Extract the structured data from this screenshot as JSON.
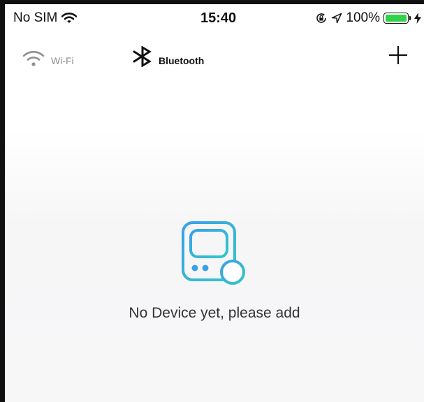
{
  "status_bar": {
    "carrier": "No SIM",
    "time": "15:40",
    "battery": "100%",
    "battery_level": 1.0,
    "icons": [
      "wifi-signal-icon",
      "orientation-lock-icon",
      "location-arrow-icon",
      "battery-icon",
      "charging-bolt-icon"
    ]
  },
  "nav": {
    "tabs": [
      {
        "label": "Wi-Fi",
        "icon": "wifi-icon",
        "active": false
      },
      {
        "label": "Bluetooth",
        "icon": "bluetooth-icon",
        "active": true
      }
    ],
    "add_icon": "plus-icon"
  },
  "empty_state": {
    "icon": "device-add-icon",
    "message": "No Device yet, please add"
  },
  "colors": {
    "accent_start": "#3aa0e8",
    "accent_end": "#34c6c9",
    "inactive": "#8e8e93",
    "battery_green": "#2fd24a"
  }
}
